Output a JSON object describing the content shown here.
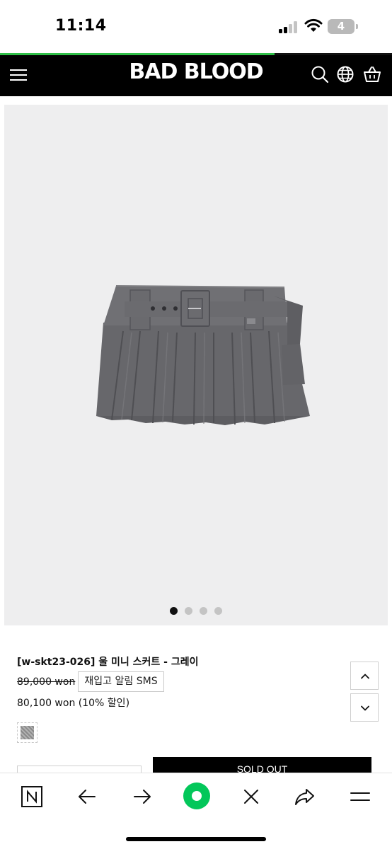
{
  "status_bar": {
    "time": "11:14",
    "battery_level": "4",
    "icons": [
      "cellular-signal-icon",
      "wifi-icon",
      "battery-icon"
    ]
  },
  "page_load_progress": 0.7,
  "header": {
    "logo": "BAD BLOOD",
    "icons": [
      "menu-icon",
      "search-icon",
      "globe-icon",
      "cart-icon"
    ],
    "background_color": "#000000",
    "progress_color": "#2fbf47"
  },
  "gallery": {
    "image": "gray-pleated-belted-mini-skirt",
    "image_count": 4,
    "active_index": 0
  },
  "product": {
    "title": "[w-skt23-026] 울 미니 스커트 - 그레이",
    "original_price": "89,000 won",
    "restock_button_label": "재입고 알림 SMS",
    "sale_price": "80,100 won (10% 할인)",
    "color_swatch": "gray-melange",
    "sold_out_label": "SOLD OUT"
  },
  "page_scroll_buttons": [
    "chevron-up-icon",
    "chevron-down-icon"
  ],
  "browser_toolbar": {
    "items": [
      "naver-home-icon",
      "back-arrow-icon",
      "forward-arrow-icon",
      "green-dot-icon",
      "close-icon",
      "share-icon",
      "more-menu-icon"
    ],
    "accent_color": "#03c75a"
  }
}
